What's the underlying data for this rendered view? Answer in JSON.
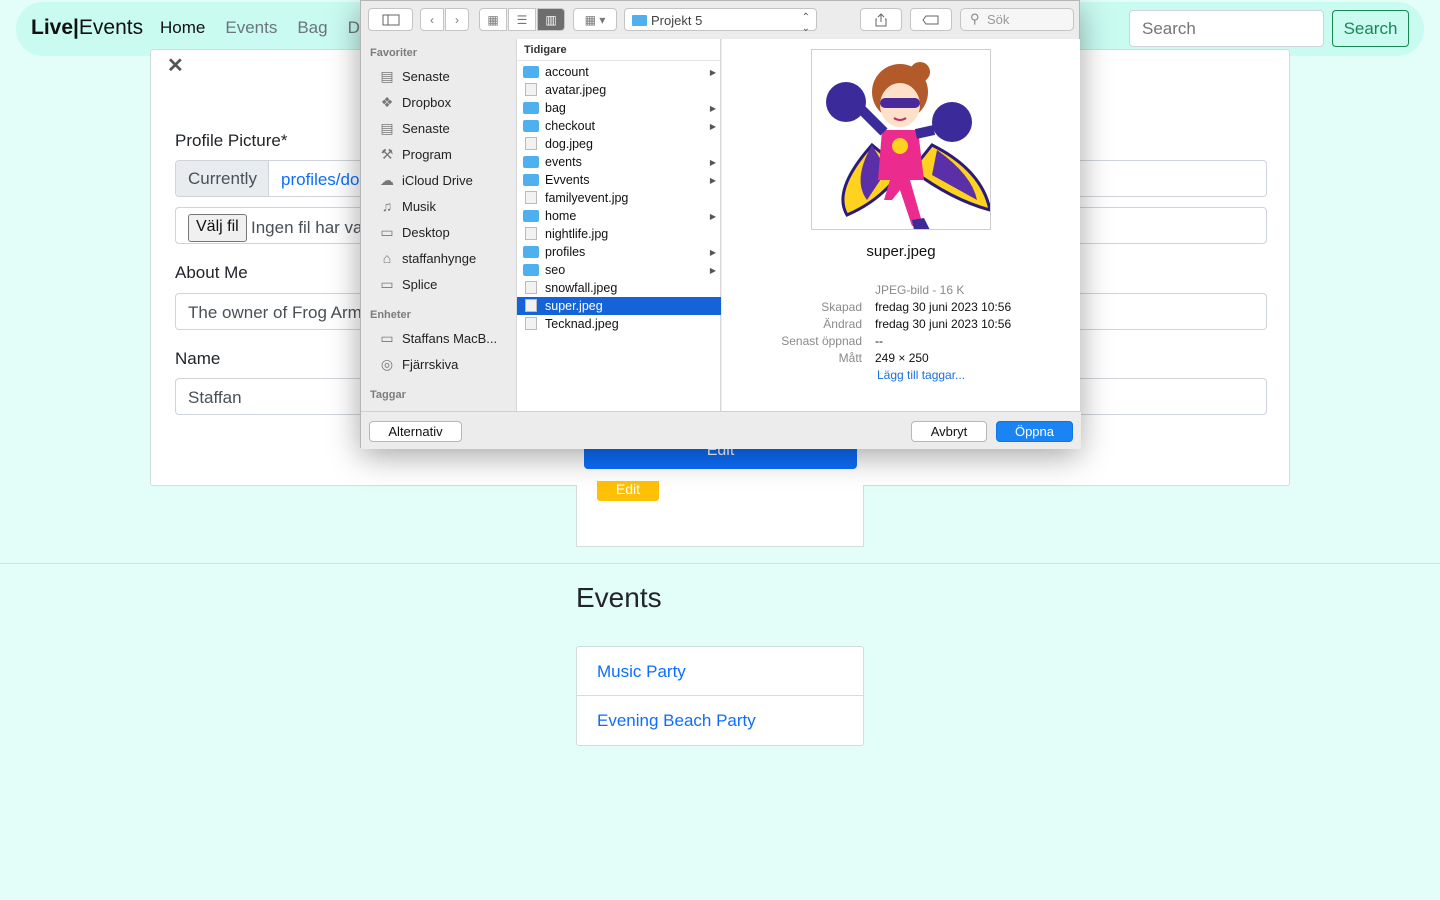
{
  "navbar": {
    "brand_bold": "Live|",
    "brand_rest": "Events",
    "links": [
      "Home",
      "Events",
      "Bag",
      "Drop"
    ],
    "search_placeholder": "Search",
    "search_button": "Search"
  },
  "modal": {
    "close_glyph": "✕",
    "profile_label": "Profile Picture*",
    "currently_label": "Currently",
    "current_link": "profiles/dog",
    "file_button": "Välj fil",
    "file_status": "Ingen fil har val",
    "about_label": "About Me",
    "about_value": "The owner of Frog Arms",
    "name_label": "Name",
    "name_value": "Staffan",
    "edit_button": "Edit",
    "edit_button_2": "Edit"
  },
  "events": {
    "title": "Events",
    "items": [
      "Music Party",
      "Evening Beach Party"
    ]
  },
  "dialog": {
    "path": "Projekt 5",
    "search_placeholder": "Sök",
    "favorites_header": "Favoriter",
    "favorites": [
      {
        "label": "Senaste",
        "icon": "recents-icon"
      },
      {
        "label": "Dropbox",
        "icon": "dropbox-icon"
      },
      {
        "label": "Senaste",
        "icon": "recents-icon"
      },
      {
        "label": "Program",
        "icon": "applications-icon"
      },
      {
        "label": "iCloud Drive",
        "icon": "cloud-icon"
      },
      {
        "label": "Musik",
        "icon": "music-icon"
      },
      {
        "label": "Desktop",
        "icon": "desktop-icon"
      },
      {
        "label": "staffanhynge",
        "icon": "home-icon"
      },
      {
        "label": "Splice",
        "icon": "folder-icon"
      }
    ],
    "devices_header": "Enheter",
    "devices": [
      {
        "label": "Staffans MacB...",
        "icon": "laptop-icon"
      },
      {
        "label": "Fjärrskiva",
        "icon": "disc-icon"
      }
    ],
    "tags_header": "Taggar",
    "column_header": "Tidigare",
    "files": [
      {
        "name": "account",
        "folder": true
      },
      {
        "name": "avatar.jpeg",
        "folder": false
      },
      {
        "name": "bag",
        "folder": true
      },
      {
        "name": "checkout",
        "folder": true
      },
      {
        "name": "dog.jpeg",
        "folder": false
      },
      {
        "name": "events",
        "folder": true
      },
      {
        "name": "Evvents",
        "folder": true
      },
      {
        "name": "familyevent.jpg",
        "folder": false
      },
      {
        "name": "home",
        "folder": true
      },
      {
        "name": "nightlife.jpg",
        "folder": false
      },
      {
        "name": "profiles",
        "folder": true
      },
      {
        "name": "seo",
        "folder": true
      },
      {
        "name": "snowfall.jpeg",
        "folder": false
      },
      {
        "name": "super.jpeg",
        "folder": false,
        "selected": true
      },
      {
        "name": "Tecknad.jpeg",
        "folder": false
      }
    ],
    "preview": {
      "filename": "super.jpeg",
      "kind": "JPEG-bild - 16 K",
      "created_label": "Skapad",
      "created_value": "fredag 30 juni 2023 10:56",
      "modified_label": "Ändrad",
      "modified_value": "fredag 30 juni 2023 10:56",
      "opened_label": "Senast öppnad",
      "opened_value": "--",
      "size_label": "Mått",
      "size_value": "249 × 250",
      "add_tags": "Lägg till taggar..."
    },
    "options_button": "Alternativ",
    "cancel_button": "Avbryt",
    "open_button": "Öppna"
  }
}
